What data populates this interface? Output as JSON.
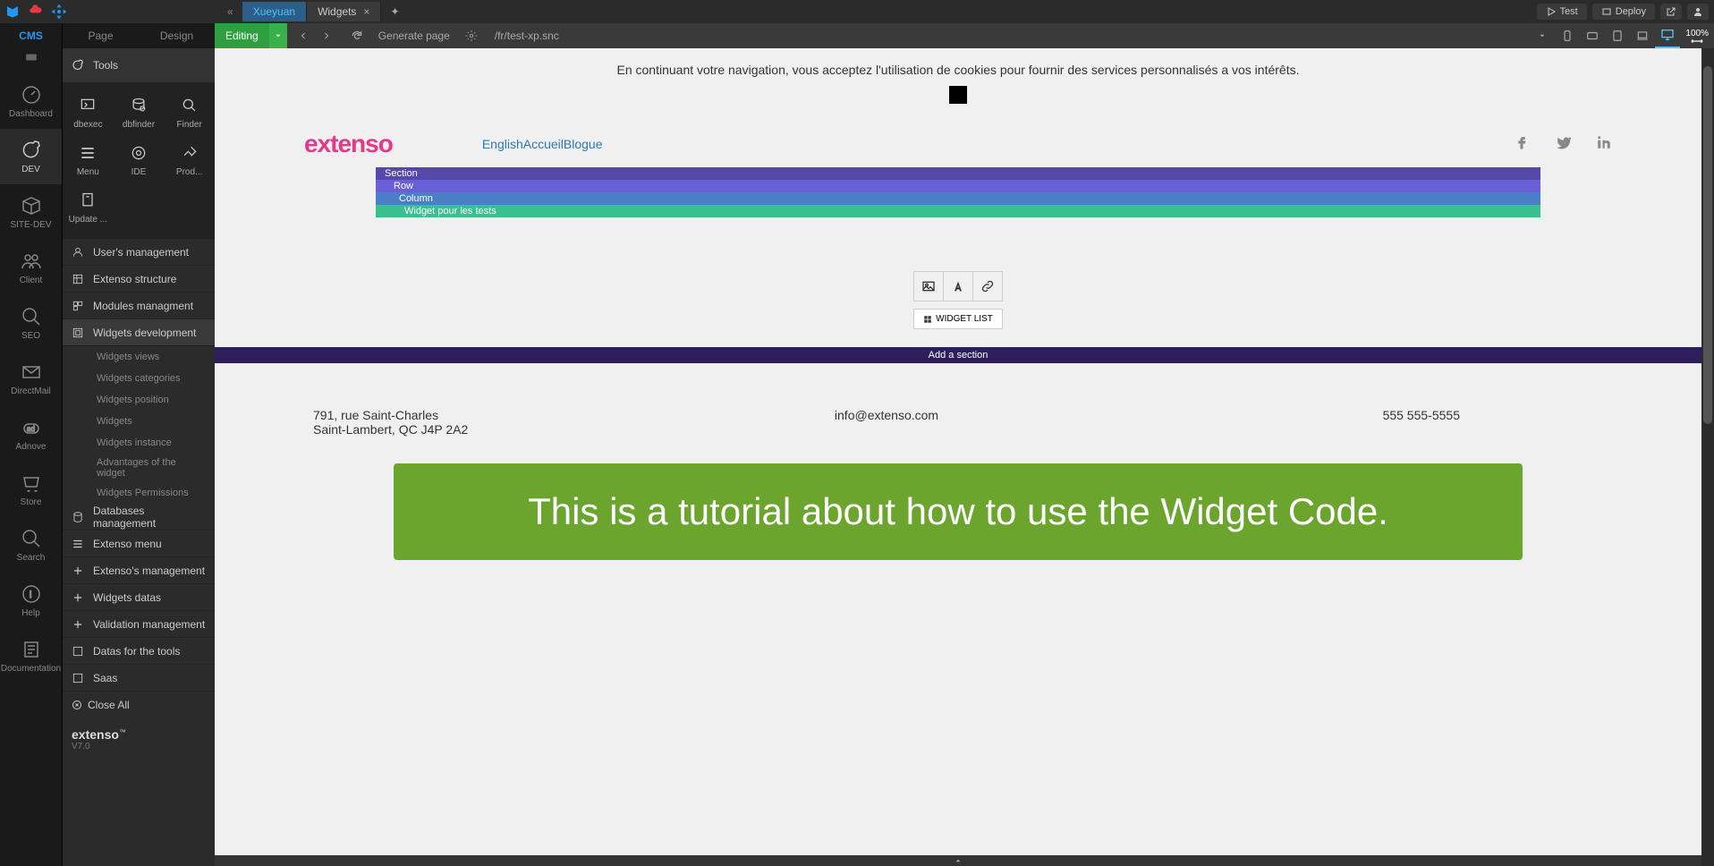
{
  "topbar": {
    "tabs": [
      {
        "label": "Xueyuan",
        "active": true
      },
      {
        "label": "Widgets",
        "active": false,
        "closable": true
      }
    ],
    "test_btn": "Test",
    "deploy_btn": "Deploy"
  },
  "leftrail": {
    "header": "CMS",
    "items": [
      {
        "label": "Dashboard"
      },
      {
        "label": "DEV"
      },
      {
        "label": "SITE-DEV"
      },
      {
        "label": "Client"
      },
      {
        "label": "SEO"
      },
      {
        "label": "DirectMail"
      },
      {
        "label": "Adnove"
      },
      {
        "label": "Store"
      },
      {
        "label": "Search"
      },
      {
        "label": "Help"
      },
      {
        "label": "Documentation"
      }
    ]
  },
  "sidepanel": {
    "tabs": {
      "page": "Page",
      "design": "Design"
    },
    "tools_label": "Tools",
    "tools": [
      {
        "label": "dbexec"
      },
      {
        "label": "dbfinder"
      },
      {
        "label": "Finder"
      },
      {
        "label": "Menu"
      },
      {
        "label": "IDE"
      },
      {
        "label": "Prod..."
      },
      {
        "label": "Update ..."
      }
    ],
    "menu": [
      {
        "label": "User's management"
      },
      {
        "label": "Extenso structure"
      },
      {
        "label": "Modules managment"
      },
      {
        "label": "Widgets development",
        "active": true
      },
      {
        "label": "Databases management"
      },
      {
        "label": "Extenso menu"
      },
      {
        "label": "Extenso's management"
      },
      {
        "label": "Widgets datas"
      },
      {
        "label": "Validation management"
      },
      {
        "label": "Datas for the tools"
      },
      {
        "label": "Saas"
      }
    ],
    "submenu": [
      "Widgets views",
      "Widgets categories",
      "Widgets position",
      "Widgets",
      "Widgets instance",
      "Advantages of the widget",
      "Widgets Permissions"
    ],
    "close_all": "Close All",
    "brand": "extenso",
    "version": "V7.0"
  },
  "maintoolbar": {
    "editing": "Editing",
    "generate": "Generate page",
    "url": "/fr/test-xp.snc",
    "zoom": "100%"
  },
  "canvas": {
    "cookie_text": "En continuant votre navigation, vous acceptez l'utilisation de cookies pour fournir des services personnalisés a vos intérêts.",
    "logo": "extenso",
    "nav": {
      "lang": "English",
      "home": "Accueil",
      "blog": "Blogue"
    },
    "bars": {
      "section": "Section",
      "row": "Row",
      "column": "Column",
      "widget": "Widget pour les tests"
    },
    "widget_list": "WIDGET LIST",
    "add_section": "Add a section",
    "footer": {
      "address1": "791, rue Saint-Charles",
      "address2": "Saint-Lambert, QC J4P 2A2",
      "email": "info@extenso.com",
      "phone": "555 555-5555"
    },
    "tutorial": "This is a tutorial about how to use the Widget Code."
  }
}
